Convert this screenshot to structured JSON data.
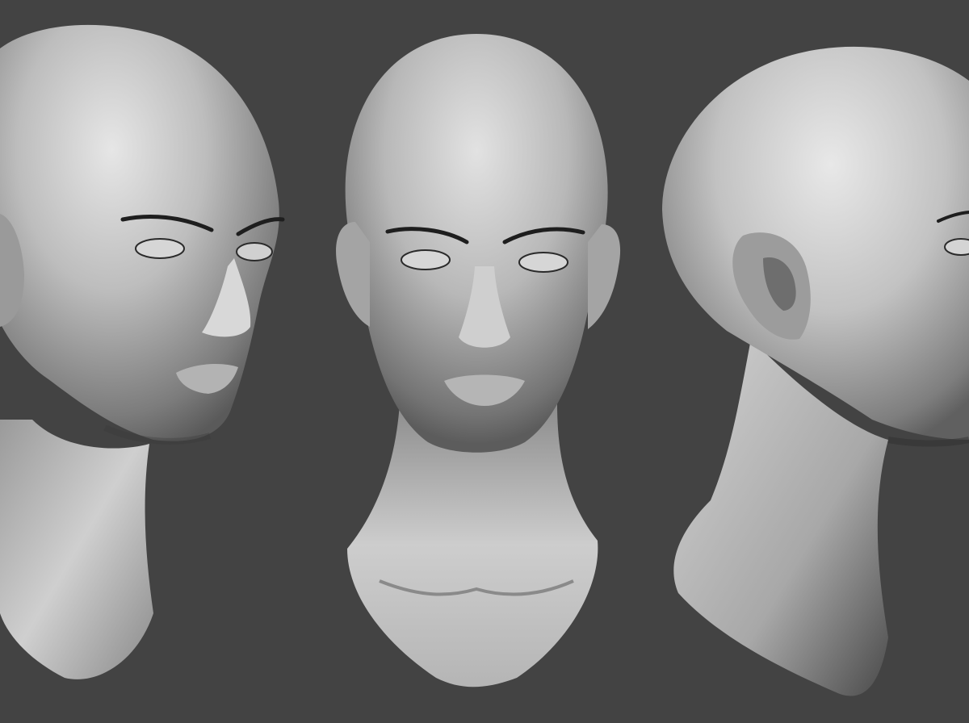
{
  "scene": {
    "background_color": "#434343",
    "model_color": "#c8c8c8",
    "views": [
      {
        "id": "three-quarter-left",
        "description_icon": "head-three-quarter-icon"
      },
      {
        "id": "front",
        "description_icon": "head-front-icon"
      },
      {
        "id": "three-quarter-right",
        "description_icon": "head-profile-icon"
      }
    ]
  }
}
